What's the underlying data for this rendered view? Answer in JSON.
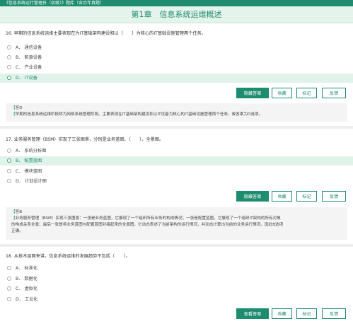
{
  "header": {
    "app_title": "《信息系统运行管理员（初级）》题库（含历年真题）",
    "chapter_title": "第1章　信息系统运维概述"
  },
  "colors": {
    "accent": "#1e8c6e",
    "selected_bg": "#e0f3ea"
  },
  "icons": {
    "radio": "radio-circle-icon"
  },
  "questions": [
    {
      "text": "16. 早期的信息系统运维主要表现在为IT基础架构建设和以（　　）为核心的IT基础设施管理两个任务。",
      "options": [
        {
          "label": "A． 通信设备",
          "selected": false
        },
        {
          "label": "B． 能源设备",
          "selected": false
        },
        {
          "label": "C． 产业设备",
          "selected": false
        },
        {
          "label": "D． IT设备",
          "selected": true
        }
      ],
      "buttons": [
        "隐藏答案",
        "收藏",
        "标记",
        "反馈"
      ],
      "answer": {
        "answer_line": "答D",
        "explanation": [
          "早期的信息系统运维阶段称为网络系统管理阶段。主要表现在IT基础架构建设和以IT设备为核心的IT基础设施管理两个任务，故答案为D选项。"
        ]
      }
    },
    {
      "text": "17. 业务服务管理（BSM）实现了三张图景，分别是业务蓝图、（　　）、全景图。",
      "options": [
        {
          "label": "A． 系统分析图",
          "selected": false
        },
        {
          "label": "B． 配置蓝图",
          "selected": true
        },
        {
          "label": "C． 模块蓝图",
          "selected": false
        },
        {
          "label": "D． 计划设计图",
          "selected": false
        }
      ],
      "buttons": [
        "隐藏答案",
        "收藏",
        "标记",
        "反馈"
      ],
      "answer": {
        "answer_line": "答B",
        "explanation": [
          "业务服务管理（BSM）实现三张图景：一张是业务蓝图，它展现了一个组织所有业务的构成情况；一张是配置蓝图，它展现了一个组织IT架构的所有对象",
          "的构成关系全景；最后一张是将业务蓝图与配置蓝图对接起来的全景图，它动态表述了当前架构的运行情况，并动态计算出当前的业务运行情况。因此B选项",
          "正确。"
        ]
      }
    },
    {
      "text": "18. 从技术层面来讲，信息系统运维的发展趋势不包括（　　）。",
      "options": [
        {
          "label": "A． 标准化",
          "selected": false
        },
        {
          "label": "B． 数据化",
          "selected": false
        },
        {
          "label": "C． 虚拟化",
          "selected": false
        },
        {
          "label": "D． 工业化",
          "selected": false
        }
      ],
      "buttons": [
        "查看答案",
        "收藏",
        "标记",
        "反馈"
      ]
    }
  ]
}
